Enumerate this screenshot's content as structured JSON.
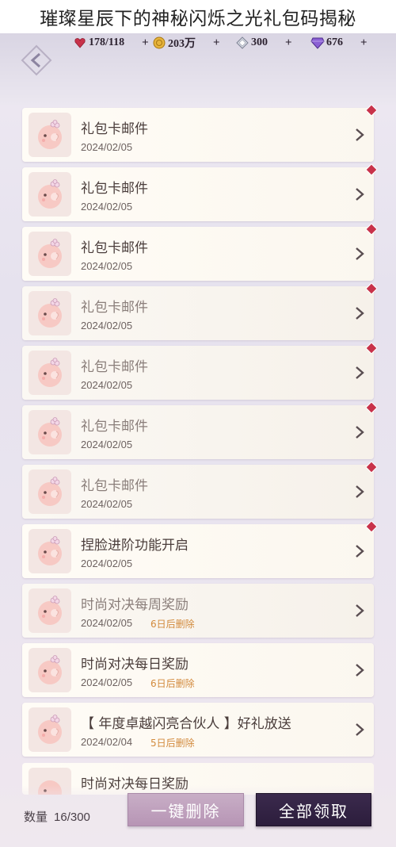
{
  "headline": "璀璨星辰下的神秘闪烁之光礼包码揭秘",
  "currencies": [
    {
      "icon": "heart-gem-icon",
      "value": "178/118",
      "color": "#c8324a"
    },
    {
      "icon": "gold-coin-icon",
      "value": "203万",
      "color": "#e0a830"
    },
    {
      "icon": "silver-diamond-icon",
      "value": "300",
      "color": "#b8bcc8"
    },
    {
      "icon": "purple-diamond-icon",
      "value": "676",
      "color": "#7a4fc8"
    }
  ],
  "plus_label": "+",
  "mails": [
    {
      "title": "礼包卡邮件",
      "date": "2024/02/05",
      "expire": "",
      "unread": true,
      "dim": false
    },
    {
      "title": "礼包卡邮件",
      "date": "2024/02/05",
      "expire": "",
      "unread": true,
      "dim": false
    },
    {
      "title": "礼包卡邮件",
      "date": "2024/02/05",
      "expire": "",
      "unread": true,
      "dim": false
    },
    {
      "title": "礼包卡邮件",
      "date": "2024/02/05",
      "expire": "",
      "unread": true,
      "dim": true
    },
    {
      "title": "礼包卡邮件",
      "date": "2024/02/05",
      "expire": "",
      "unread": true,
      "dim": true
    },
    {
      "title": "礼包卡邮件",
      "date": "2024/02/05",
      "expire": "",
      "unread": true,
      "dim": true
    },
    {
      "title": "礼包卡邮件",
      "date": "2024/02/05",
      "expire": "",
      "unread": true,
      "dim": true
    },
    {
      "title": "捏脸进阶功能开启",
      "date": "2024/02/05",
      "expire": "",
      "unread": true,
      "dim": false
    },
    {
      "title": "时尚对决每周奖励",
      "date": "2024/02/05",
      "expire": "6日后删除",
      "unread": false,
      "dim": true
    },
    {
      "title": "时尚对决每日奖励",
      "date": "2024/02/05",
      "expire": "6日后删除",
      "unread": false,
      "dim": false
    },
    {
      "title": "【 年度卓越闪亮合伙人 】好礼放送",
      "date": "2024/02/04",
      "expire": "5日后删除",
      "unread": false,
      "dim": false
    }
  ],
  "peek_title": "时尚对决每日奖励",
  "footer": {
    "count_label": "数量",
    "count_value": "16/300",
    "delete_label": "一键删除",
    "claim_label": "全部领取"
  },
  "colors": {
    "accent_dark": "#2c1d3c",
    "delete_button": "#b795b5",
    "expire_text": "#d28a3c",
    "unread_badge": "#c8324a"
  }
}
